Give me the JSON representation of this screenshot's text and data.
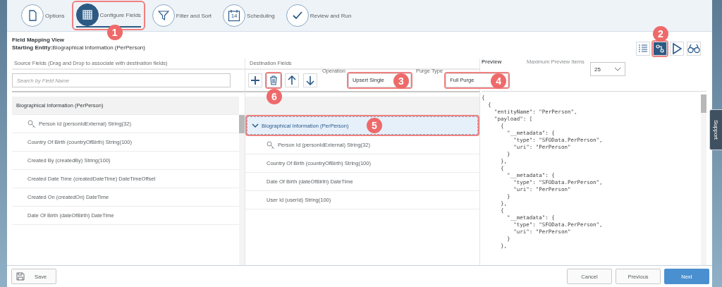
{
  "steps": [
    {
      "label": "Options",
      "kind": "document",
      "selected": false
    },
    {
      "label": "Configure Fields",
      "kind": "grid",
      "selected": true,
      "callout": "1"
    },
    {
      "label": "Filter and Sort",
      "kind": "filter",
      "selected": false
    },
    {
      "label": "Scheduling",
      "kind": "calendar",
      "selected": false,
      "day": "14"
    },
    {
      "label": "Review and Run",
      "kind": "check",
      "selected": false
    }
  ],
  "header": {
    "title": "Field Mapping View",
    "entity_label": "Starting Entity:",
    "entity": "Biographical Information (PerPerson)"
  },
  "views": [
    {
      "kind": "list",
      "selected": false
    },
    {
      "kind": "mapping",
      "selected": true,
      "callout": "2"
    },
    {
      "kind": "run",
      "selected": false
    },
    {
      "kind": "glasses",
      "selected": false
    }
  ],
  "source": {
    "heading": "Source Fields (Drag and Drop to associate with destination fields)",
    "search": {
      "placeholder": "Search by Field Name"
    },
    "group": "Biographical Information (PerPerson)",
    "rows": [
      {
        "label": "Person Id (personIdExternal) String(32)",
        "key": true
      },
      {
        "label": "Country Of Birth (countryOfBirth) String(100)",
        "key": false
      },
      {
        "label": "Created By (createdBy) String(100)",
        "key": false
      },
      {
        "label": "Created Date Time (createdDateTime) DateTimeOffset",
        "key": false
      },
      {
        "label": "Created On (createdOn) DateTime",
        "key": false
      },
      {
        "label": "Date Of Birth (dateOfBirth) DateTime",
        "key": false
      }
    ]
  },
  "destination": {
    "heading": "Destination Fields",
    "tools": [
      {
        "kind": "add"
      },
      {
        "kind": "delete",
        "callout": "6"
      },
      {
        "kind": "up"
      },
      {
        "kind": "down"
      }
    ],
    "operation": {
      "label": "Operation",
      "value": "Upsert Single",
      "callout": "3"
    },
    "purge": {
      "label": "Purge Type",
      "value": "Full Purge",
      "callout": "4"
    },
    "group": {
      "label": "Biographical Information (PerPerson)",
      "expanded": true,
      "selected": true,
      "callout": "5"
    },
    "rows": [
      {
        "label": "Person Id (personIdExternal) String(32)",
        "key": true
      },
      {
        "label": "Country Of Birth (countryOfBirth) String(100)",
        "key": false
      },
      {
        "label": "Date Of Birth (dateOfBirth) DateTime",
        "key": false
      },
      {
        "label": "User Id (userId) String(100)",
        "key": false
      }
    ]
  },
  "preview": {
    "title": "Preview",
    "max_label": "Maximum Preview Items",
    "max_value": "25",
    "lines": [
      "{",
      "  {",
      "    \"entityName\": \"PerPerson\",",
      "    \"payload\": [",
      "      {",
      "        \"__metadata\": {",
      "          \"type\": \"SFOData.PerPerson\",",
      "          \"uri\": \"PerPerson\"",
      "        }",
      "      },",
      "      {",
      "        \"__metadata\": {",
      "          \"type\": \"SFOData.PerPerson\",",
      "          \"uri\": \"PerPerson\"",
      "        }",
      "      },",
      "      {",
      "        \"__metadata\": {",
      "          \"type\": \"SFOData.PerPerson\",",
      "          \"uri\": \"PerPerson\"",
      "        }",
      "      },"
    ]
  },
  "support": "Support",
  "footer": {
    "save": "Save",
    "buttons": [
      {
        "label": "Cancel",
        "primary": false
      },
      {
        "label": "Previous",
        "primary": false
      },
      {
        "label": "Next",
        "primary": true
      }
    ]
  }
}
